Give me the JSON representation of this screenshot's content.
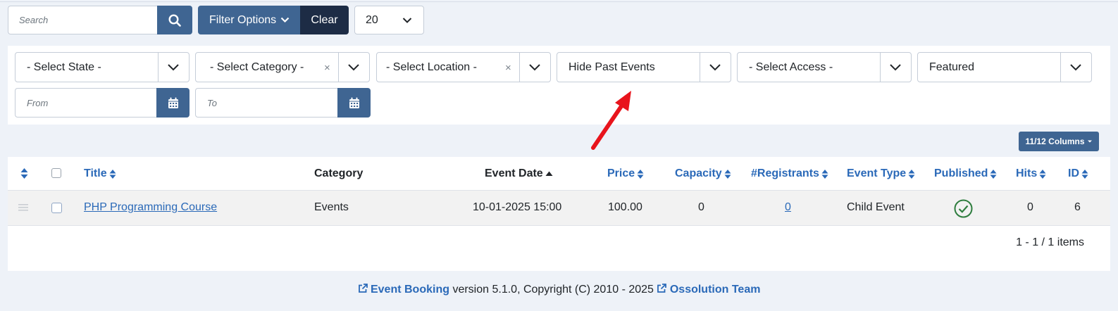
{
  "toolbar": {
    "search_placeholder": "Search",
    "filter_options_label": "Filter Options",
    "clear_label": "Clear",
    "list_limit": "20"
  },
  "filters": {
    "state": "- Select State -",
    "category": "- Select Category -",
    "location": "- Select Location -",
    "past_events": "Hide Past Events",
    "access": "- Select Access -",
    "featured": "Featured",
    "from_placeholder": "From",
    "to_placeholder": "To"
  },
  "columns_button": "11/12 Columns",
  "table": {
    "headers": {
      "title": "Title",
      "category": "Category",
      "event_date": "Event Date",
      "price": "Price",
      "capacity": "Capacity",
      "registrants": "#Registrants",
      "event_type": "Event Type",
      "published": "Published",
      "hits": "Hits",
      "id": "ID"
    },
    "rows": [
      {
        "title": "PHP Programming Course",
        "category": "Events",
        "event_date": "10-01-2025 15:00",
        "price": "100.00",
        "capacity": "0",
        "registrants": "0",
        "event_type": "Child Event",
        "published": true,
        "hits": "0",
        "id": "6"
      }
    ],
    "pagination_text": "1 - 1 / 1 items"
  },
  "footer": {
    "product_link": "Event Booking",
    "version_text": "version 5.1.0, Copyright (C) 2010 - 2025",
    "team_link": "Ossolution Team"
  },
  "colors": {
    "primary": "#3f6592",
    "dark": "#1d2c45",
    "link": "#2a69b8",
    "published_green": "#2e7d3e",
    "annotation_arrow": "#e8141c"
  }
}
